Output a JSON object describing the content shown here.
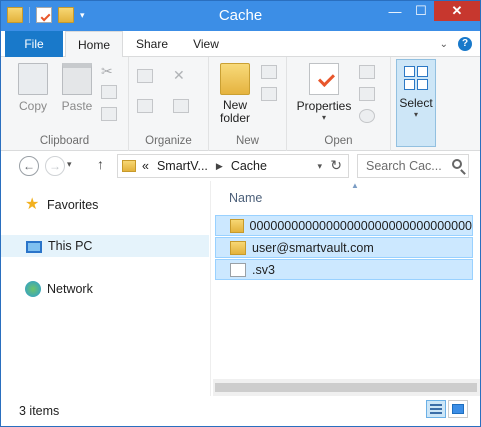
{
  "window": {
    "title": "Cache",
    "close_glyph": "✕",
    "minimize_glyph": "—",
    "maximize_glyph": "☐"
  },
  "ribbon": {
    "tabs": [
      "File",
      "Home",
      "Share",
      "View"
    ],
    "help_glyph": "?",
    "groups": {
      "clipboard": {
        "label": "Clipboard",
        "copy": "Copy",
        "paste": "Paste"
      },
      "organize": {
        "label": "Organize"
      },
      "new": {
        "label": "New",
        "new_folder_line1": "New",
        "new_folder_line2": "folder"
      },
      "open": {
        "label": "Open",
        "properties": "Properties"
      },
      "select": {
        "label": "Select"
      }
    }
  },
  "address": {
    "back_glyph": "←",
    "forward_glyph": "→",
    "up_glyph": "↑",
    "overflow": "«",
    "crumbs": [
      "SmartV...",
      "Cache"
    ],
    "search_placeholder": "Search Cac..."
  },
  "nav_pane": {
    "favorites": "Favorites",
    "this_pc": "This PC",
    "network": "Network"
  },
  "file_list": {
    "column_name": "Name",
    "files": [
      {
        "name": "00000000000000000000000000000000",
        "icon": "folder-icon"
      },
      {
        "name": "user@smartvault.com",
        "icon": "folder-icon"
      },
      {
        "name": ".sv3",
        "icon": "file-icon"
      }
    ]
  },
  "status": {
    "item_count": "3 items"
  }
}
